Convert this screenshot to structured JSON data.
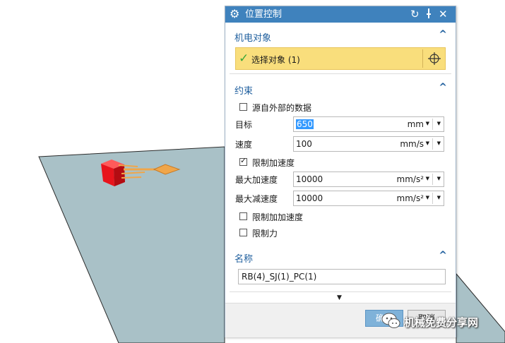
{
  "dialog": {
    "title": "位置控制",
    "icons": {
      "settings": "gear-icon",
      "reset": "reset-icon",
      "pin": "pin-icon",
      "close": "close-icon"
    }
  },
  "groups": {
    "mechatronic_object": {
      "title": "机电对象",
      "select_object_label": "选择对象 (1)"
    },
    "constraint": {
      "title": "约束",
      "external_data_label": "源自外部的数据",
      "target_label": "目标",
      "target_value": "650",
      "target_unit": "mm",
      "speed_label": "速度",
      "speed_value": "100",
      "speed_unit": "mm/s",
      "limit_accel_label": "限制加速度",
      "max_accel_label": "最大加速度",
      "max_accel_value": "10000",
      "max_accel_unit": "mm/s²",
      "max_decel_label": "最大减速度",
      "max_decel_value": "10000",
      "max_decel_unit": "mm/s²",
      "limit_jerk_label": "限制加加速度",
      "limit_force_label": "限制力"
    },
    "name": {
      "title": "名称",
      "value": "RB(4)_SJ(1)_PC(1)"
    }
  },
  "footer": {
    "ok_label": "确定",
    "cancel_label": "取消"
  },
  "watermark": {
    "text": "机械免费分享网"
  },
  "colors": {
    "titlebar": "#3f82bd",
    "group_title": "#1f5f9e",
    "selection_highlight": "#f9de7c",
    "plane": "#a9c1c7",
    "cube": "#e8141c",
    "arrow": "#f0a64a"
  }
}
